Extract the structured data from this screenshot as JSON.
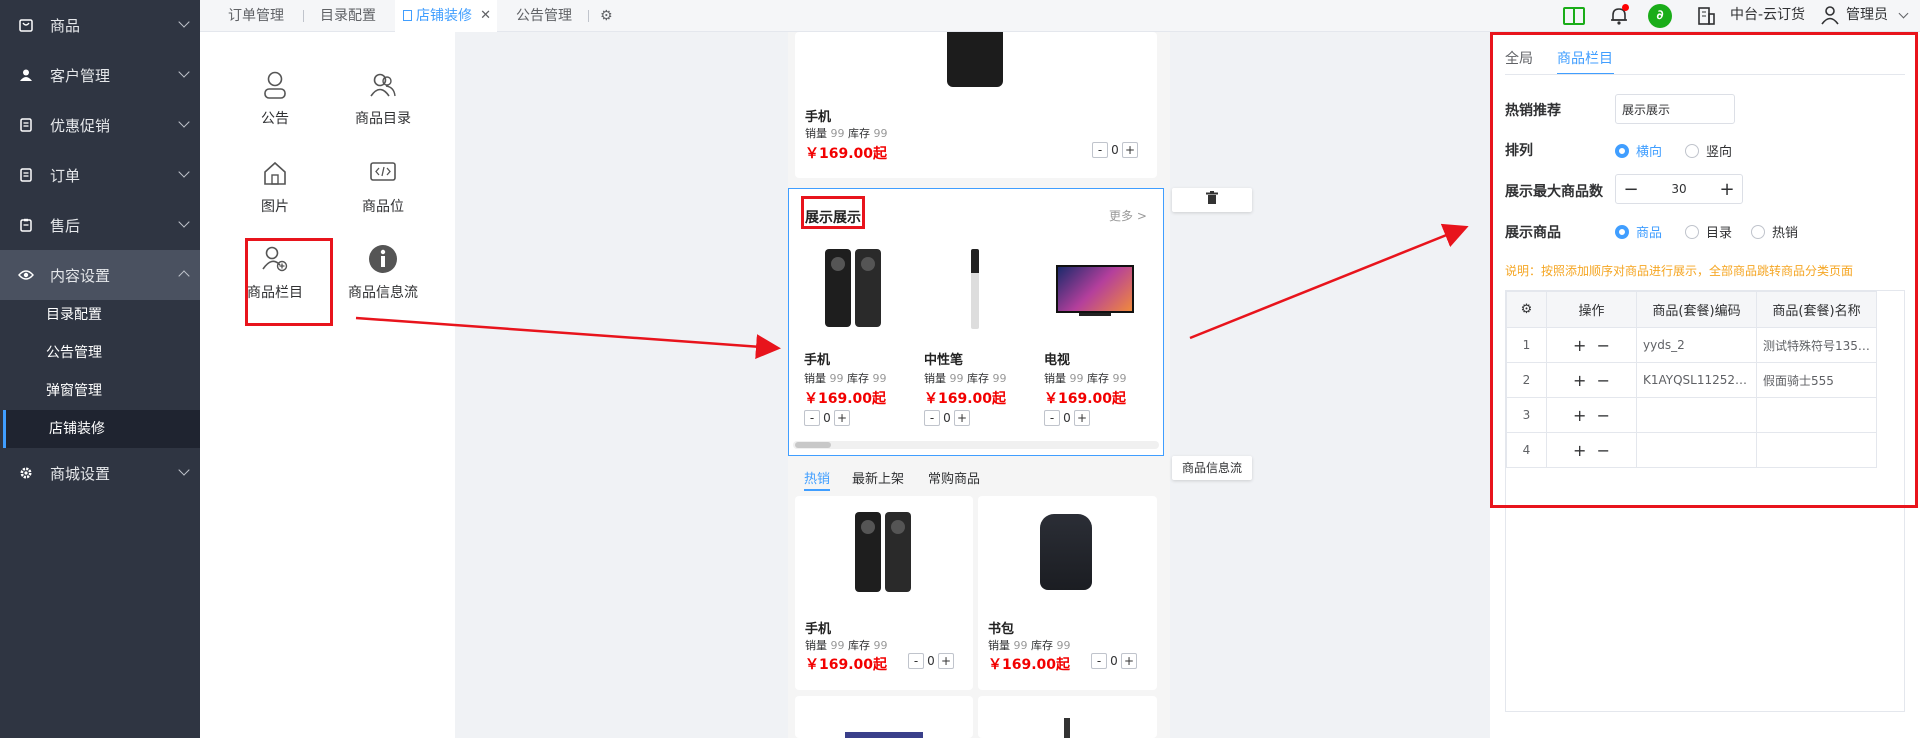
{
  "sidebar": {
    "items": [
      {
        "label": "商品",
        "icon": "goods-icon"
      },
      {
        "label": "客户管理",
        "icon": "user-icon"
      },
      {
        "label": "优惠促销",
        "icon": "coupon-icon"
      },
      {
        "label": "订单",
        "icon": "order-icon"
      },
      {
        "label": "售后",
        "icon": "aftersale-icon"
      },
      {
        "label": "内容设置",
        "icon": "eye-icon"
      },
      {
        "label": "商城设置",
        "icon": "gear-icon"
      }
    ],
    "sub_items": [
      "目录配置",
      "公告管理",
      "弹窗管理",
      "店铺装修"
    ]
  },
  "tabs": [
    "订单管理",
    "目录配置",
    "店铺装修",
    "公告管理"
  ],
  "header": {
    "company": "中台-云订货",
    "user": "管理员"
  },
  "widgets": [
    "公告",
    "商品目录",
    "图片",
    "商品位",
    "商品栏目",
    "商品信息流"
  ],
  "canvas": {
    "top_product": {
      "name": "手机",
      "sales_label": "销量",
      "sales": "99",
      "stock_label": "库存",
      "stock": "99",
      "price": "￥169.00起",
      "qty": "0"
    },
    "section": {
      "title": "展示展示",
      "more": "更多 >",
      "products": [
        {
          "name": "手机",
          "sales_label": "销量",
          "sales": "99",
          "stock_label": "库存",
          "stock": "99",
          "price": "￥169.00起",
          "qty": "0"
        },
        {
          "name": "中性笔",
          "sales_label": "销量",
          "sales": "99",
          "stock_label": "库存",
          "stock": "99",
          "price": "￥169.00起",
          "qty": "0"
        },
        {
          "name": "电视",
          "sales_label": "销量",
          "sales": "99",
          "stock_label": "库存",
          "stock": "99",
          "price": "￥169.00起",
          "qty": "0"
        }
      ]
    },
    "feed_tabs": [
      "热销",
      "最新上架",
      "常购商品"
    ],
    "feed_products": [
      {
        "name": "手机",
        "sales_label": "销量",
        "sales": "99",
        "stock_label": "库存",
        "stock": "99",
        "price": "￥169.00起",
        "qty": "0"
      },
      {
        "name": "书包",
        "sales_label": "销量",
        "sales": "99",
        "stock_label": "库存",
        "stock": "99",
        "price": "￥169.00起",
        "qty": "0"
      }
    ],
    "feed_badge": "商品信息流",
    "minus": "-",
    "plus": "+"
  },
  "panel": {
    "tabs": [
      "全局",
      "商品栏目"
    ],
    "hot_label": "热销推荐",
    "hot_value": "展示展示",
    "layout_label": "排列",
    "layout_options": [
      "横向",
      "竖向"
    ],
    "max_label": "展示最大商品数",
    "max_value": "30",
    "show_label": "展示商品",
    "show_options": [
      "商品",
      "目录",
      "热销"
    ],
    "note": "说明：按照添加顺序对商品进行展示，全部商品跳转商品分类页面",
    "table": {
      "headers": [
        "操作",
        "商品(套餐)编码",
        "商品(套餐)名称"
      ],
      "rows": [
        {
          "idx": "1",
          "code": "yyds_2",
          "name": "测试特殊符号135g..."
        },
        {
          "idx": "2",
          "code": "K1AYQSL1125200...",
          "name": "假面骑士555"
        },
        {
          "idx": "3",
          "code": "",
          "name": ""
        },
        {
          "idx": "4",
          "code": "",
          "name": ""
        }
      ]
    }
  },
  "colors": {
    "sidebar": "#2f3542",
    "accent": "#409eff",
    "price": "#f20000",
    "highlight": "#e8141c",
    "note": "#f5a623"
  }
}
